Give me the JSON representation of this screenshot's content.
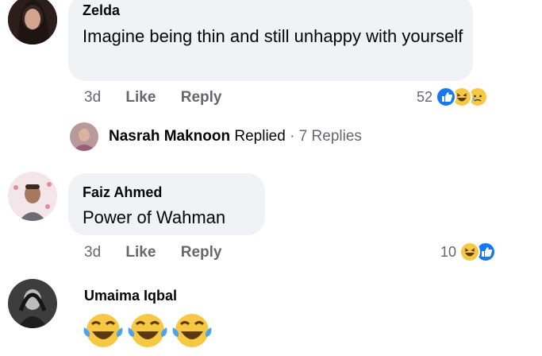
{
  "comments": [
    {
      "author": "Zelda",
      "text": "Imagine being thin and still unhappy with yourself",
      "time": "3d",
      "like_label": "Like",
      "reply_label": "Reply",
      "reaction_count": "52",
      "reactions": [
        "like-icon",
        "haha-icon",
        "sad-icon"
      ]
    },
    {
      "author": "Faiz Ahmed",
      "text": "Power of Wahman",
      "time": "3d",
      "like_label": "Like",
      "reply_label": "Reply",
      "reaction_count": "10",
      "reactions": [
        "haha-icon",
        "like-icon"
      ]
    },
    {
      "author": "Umaima Iqbal",
      "text_emoji": [
        "laughing-crying-emoji",
        "laughing-crying-emoji",
        "laughing-crying-emoji"
      ]
    }
  ],
  "reply_summary": {
    "author": "Nasrah Maknoon",
    "verb": "Replied",
    "separator": "·",
    "count": "7 Replies"
  },
  "colors": {
    "like": "#1877f2",
    "haha": "#f7c844",
    "bubble": "#f0f2f5",
    "meta": "#65676b"
  }
}
